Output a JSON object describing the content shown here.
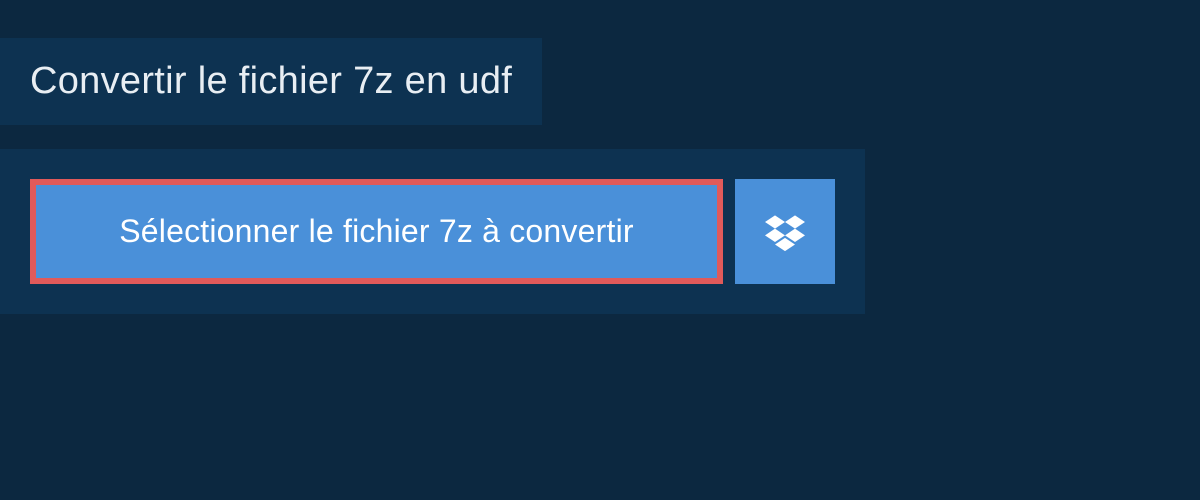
{
  "header": {
    "title": "Convertir le fichier 7z en udf"
  },
  "actions": {
    "select_file_label": "Sélectionner le fichier 7z à convertir"
  }
}
